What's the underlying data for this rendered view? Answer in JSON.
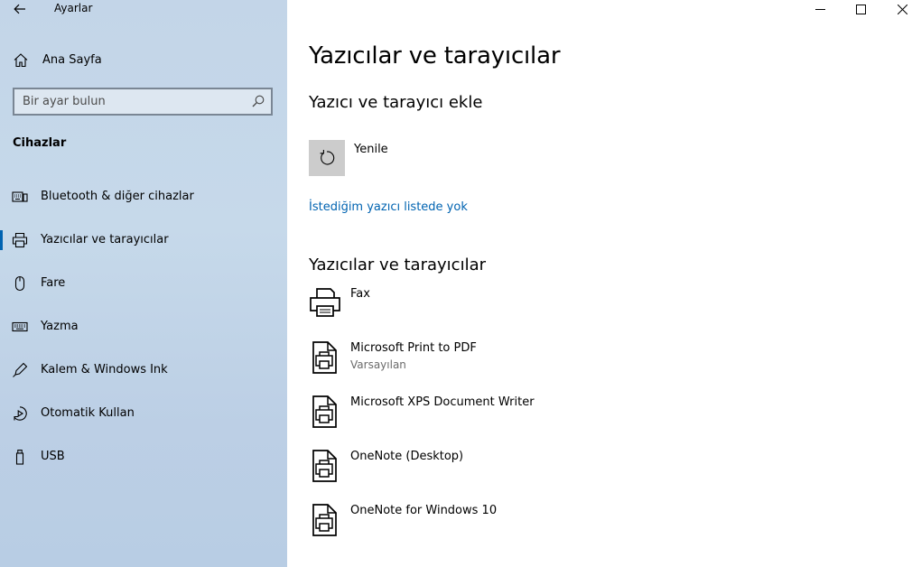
{
  "window": {
    "app_title": "Ayarlar"
  },
  "sidebar": {
    "home_label": "Ana Sayfa",
    "search_placeholder": "Bir ayar bulun",
    "section_label": "Cihazlar",
    "items": [
      {
        "label": "Bluetooth & diğer cihazlar",
        "icon": "bluetooth-devices-icon"
      },
      {
        "label": "Yazıcılar ve tarayıcılar",
        "icon": "printer-icon",
        "selected": true
      },
      {
        "label": "Fare",
        "icon": "mouse-icon"
      },
      {
        "label": "Yazma",
        "icon": "keyboard-icon"
      },
      {
        "label": "Kalem & Windows Ink",
        "icon": "pen-icon"
      },
      {
        "label": "Otomatik Kullan",
        "icon": "autoplay-icon"
      },
      {
        "label": "USB",
        "icon": "usb-icon"
      }
    ]
  },
  "main": {
    "title": "Yazıcılar ve tarayıcılar",
    "add_heading": "Yazıcı ve tarayıcı ekle",
    "refresh_label": "Yenile",
    "missing_printer_link": "İstediğim yazıcı listede yok",
    "list_heading": "Yazıcılar ve tarayıcılar",
    "printers": [
      {
        "name": "Fax",
        "status": "",
        "icon": "fax-icon"
      },
      {
        "name": "Microsoft Print to PDF",
        "status": "Varsayılan",
        "icon": "document-printer-icon"
      },
      {
        "name": "Microsoft XPS Document Writer",
        "status": "",
        "icon": "document-printer-icon"
      },
      {
        "name": "OneNote (Desktop)",
        "status": "",
        "icon": "document-printer-icon"
      },
      {
        "name": "OneNote for Windows 10",
        "status": "",
        "icon": "document-printer-icon"
      }
    ]
  },
  "colors": {
    "accent": "#0063b1",
    "sidebar_bg": "#c3d5e8",
    "tile_bg": "#cccccc"
  }
}
